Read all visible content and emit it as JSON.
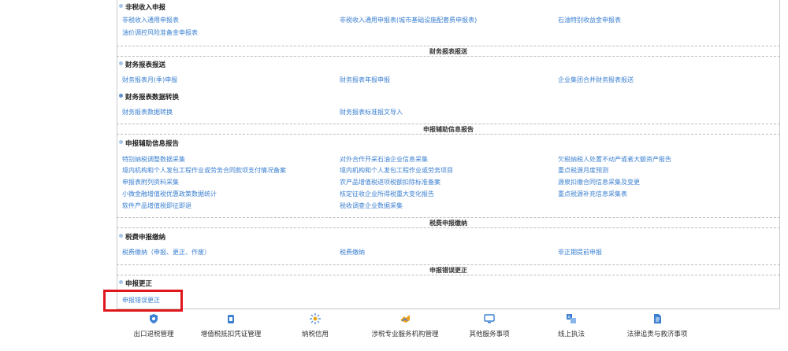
{
  "sections": [
    {
      "groups": [
        {
          "title": "非税收入申报",
          "links": [
            "非税收入通用申报表",
            "非税收入通用申报表(城市基础设施配套费申报表)",
            "石油特别收益金申报表",
            "油价调控风险准备金申报表"
          ]
        }
      ]
    },
    {
      "header": "财务报表报送",
      "groups": [
        {
          "title": "财务报表报送",
          "links": [
            "财务报表月(季)申报",
            "财务报表年报申报",
            "企业集团合并财务报表报送"
          ]
        },
        {
          "title": "财务报表数据转换",
          "links": [
            "财务报表数据转换",
            "财务报表标准报文导入"
          ]
        }
      ]
    },
    {
      "header": "申报辅助信息报告",
      "groups": [
        {
          "title": "申报辅助信息报告",
          "links": [
            "特别纳税调整数据采集",
            "对外合作开采石油企业信息采集",
            "欠税纳税人处置不动产或者大额资产报告",
            "境内机构和个人发包工程作业或劳务合同款项支付情况备案",
            "境内机构和个人发包工程作业或劳务项目",
            "重点税源月度预测",
            "申报表附列资料采集",
            "农产品增值税进项税额扣除标准备案",
            "源泉扣缴合同信息采集及变更",
            "小微金融增值税优惠政策数据统计",
            "核定征收企业所得税重大变化报告",
            "重点税源补充信息采集表",
            "软件产品增值税即征即退",
            "税收调查企业数据采集"
          ]
        }
      ]
    },
    {
      "header": "税费申报缴纳",
      "groups": [
        {
          "title": "税费申报缴纳",
          "links": [
            "税费缴纳（申报、更正、作废）",
            "税费缴纳",
            "非正期提前申报"
          ]
        }
      ]
    },
    {
      "header": "申报错误更正",
      "groups": [
        {
          "title": "申报更正",
          "links": [
            "申报错误更正"
          ]
        }
      ]
    }
  ],
  "dock": [
    {
      "label": "出口退税管理",
      "icon": "shield-icon",
      "color": "#3a7fd0"
    },
    {
      "label": "增值税抵扣凭证管理",
      "icon": "document-icon",
      "color": "#3a7fd0"
    },
    {
      "label": "纳税信用",
      "icon": "sparkle-icon",
      "color": "#e8a820"
    },
    {
      "label": "涉税专业服务机构管理",
      "icon": "handshake-icon",
      "color": "#f0a020"
    },
    {
      "label": "其他服务事项",
      "icon": "monitor-icon",
      "color": "#3a7fd0"
    },
    {
      "label": "线上执法",
      "icon": "translate-icon",
      "color": "#3a7fd0"
    },
    {
      "label": "法律追责与救济事项",
      "icon": "file-icon",
      "color": "#3a7fd0"
    }
  ],
  "colors": {
    "link": "#3a7fd0",
    "highlight": "#e0161d"
  }
}
